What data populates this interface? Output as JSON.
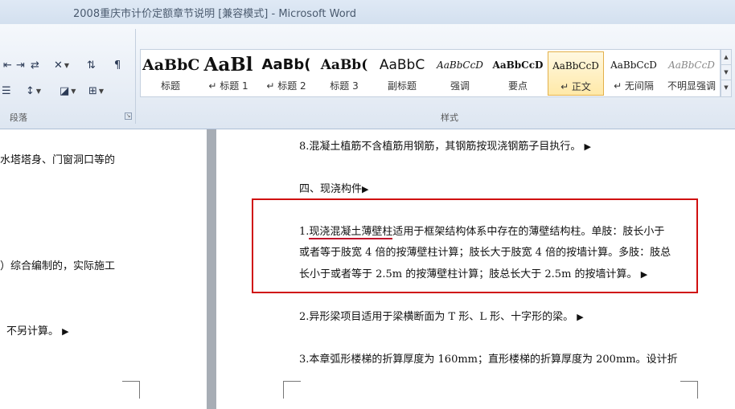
{
  "window": {
    "title": "2008重庆市计价定额章节说明 [兼容模式] - Microsoft Word"
  },
  "ribbon": {
    "paragraph_group_label": "段落",
    "styles_group_label": "样式",
    "styles": [
      {
        "sample": "AaBbC",
        "name": "标题"
      },
      {
        "sample": "AaBl",
        "name": "↵ 标题 1"
      },
      {
        "sample": "AaBb(",
        "name": "↵ 标题 2"
      },
      {
        "sample": "AaBb(",
        "name": "标题 3"
      },
      {
        "sample": "AaBbC",
        "name": "副标题"
      },
      {
        "sample": "AaBbCcD",
        "name": "强调"
      },
      {
        "sample": "AaBbCcD",
        "name": "要点"
      },
      {
        "sample": "AaBbCcD",
        "name": "↵ 正文"
      },
      {
        "sample": "AaBbCcD",
        "name": "↵ 无间隔"
      },
      {
        "sample": "AaBbCcD",
        "name": "不明显强调"
      }
    ],
    "active_style": "正文"
  },
  "left_page": {
    "lines": [
      "水塔塔身、门窗洞口等的",
      "）综合编制的，实际施工",
      "不另计算。"
    ]
  },
  "right_page": {
    "lines": [
      "8.混凝土植筋不含植筋用钢筋，其钢筋按现浇钢筋子目执行。",
      "四、现浇构件",
      "1.",
      "现浇混凝土薄壁柱",
      "适用于框架结构体系中存在的薄壁结构柱。单肢：肢长小于",
      "或者等于肢宽 4 倍的按薄壁柱计算；肢长大于肢宽 4 倍的按墙计算。多肢：肢总",
      "长小于或者等于 2.5m 的按薄壁柱计算；肢总长大于 2.5m 的按墙计算。",
      "2.异形梁项目适用于梁横断面为 T 形、L 形、十字形的梁。",
      "3.本章弧形楼梯的折算厚度为 160mm；直形楼梯的折算厚度为 200mm。设计折"
    ],
    "paragraph_mark": "▶"
  }
}
